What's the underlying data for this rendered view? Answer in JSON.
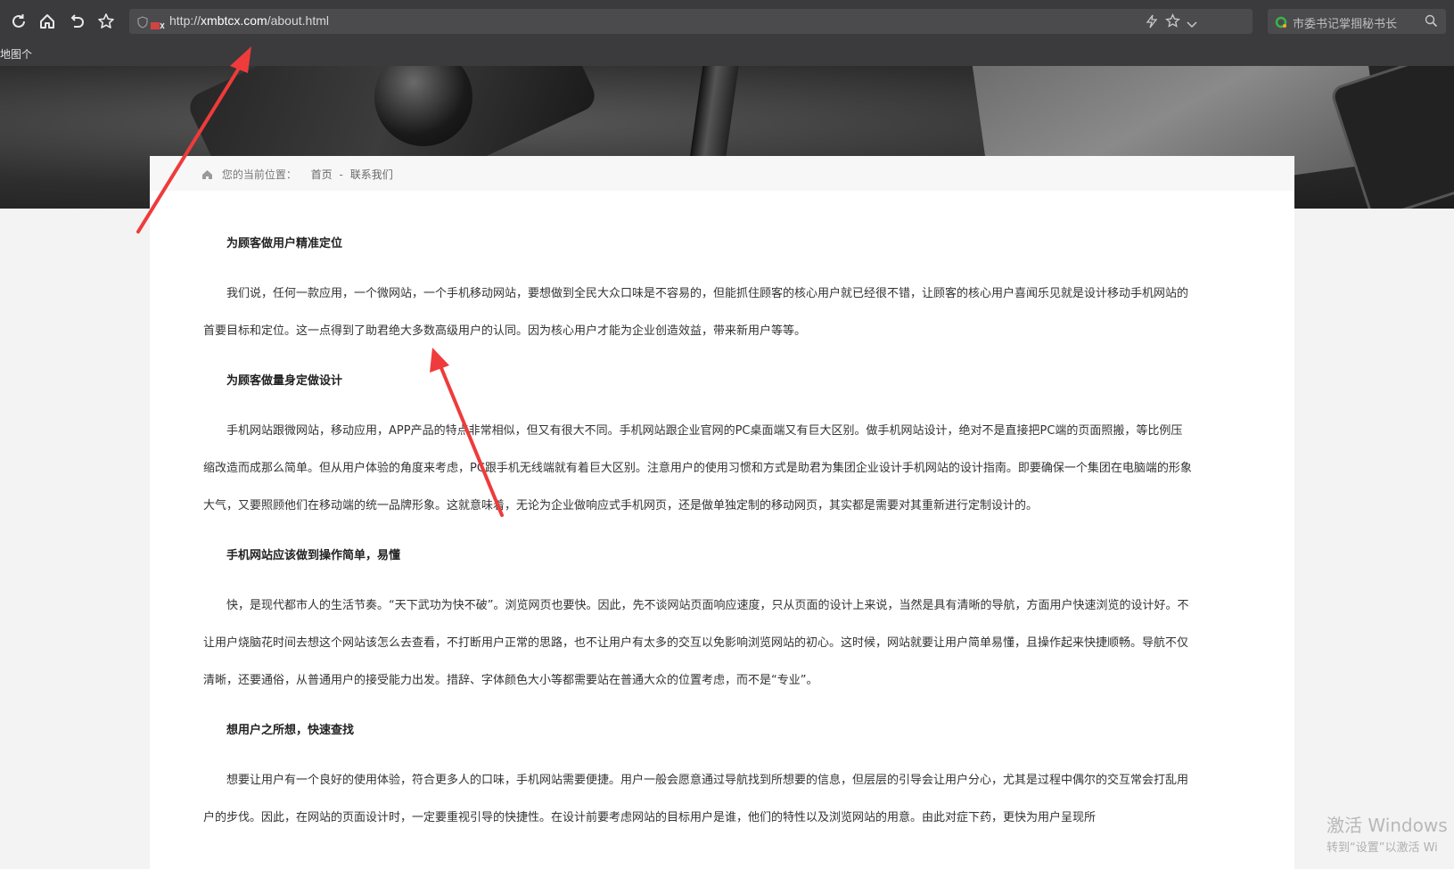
{
  "browser": {
    "url_prefix": "http://",
    "url_domain": "xmbtcx.com",
    "url_path": "/about.html",
    "search_text": "市委书记掌掴秘书长",
    "bookmark": "地图个"
  },
  "breadcrumb": {
    "label": "您的当前位置：",
    "home": "首页",
    "separator": "-",
    "current": "联系我们"
  },
  "article": {
    "sections": [
      {
        "heading": "为顾客做用户精准定位",
        "paragraph": "我们说，任何一款应用，一个微网站，一个手机移动网站，要想做到全民大众口味是不容易的，但能抓住顾客的核心用户就已经很不错，让顾客的核心用户喜闻乐见就是设计移动手机网站的首要目标和定位。这一点得到了助君绝大多数高级用户的认同。因为核心用户才能为企业创造效益，带来新用户等等。"
      },
      {
        "heading": "为顾客做量身定做设计",
        "paragraph": "手机网站跟微网站，移动应用，APP产品的特点非常相似，但又有很大不同。手机网站跟企业官网的PC桌面端又有巨大区别。做手机网站设计，绝对不是直接把PC端的页面照搬，等比例压缩改造而成那么简单。但从用户体验的角度来考虑，PC跟手机无线端就有着巨大区别。注意用户的使用习惯和方式是助君为集团企业设计手机网站的设计指南。即要确保一个集团在电脑端的形象大气，又要照顾他们在移动端的统一品牌形象。这就意味着，无论为企业做响应式手机网页，还是做单独定制的移动网页，其实都是需要对其重新进行定制设计的。"
      },
      {
        "heading": "手机网站应该做到操作简单，易懂",
        "paragraph": "快，是现代都市人的生活节奏。“天下武功为快不破”。浏览网页也要快。因此，先不谈网站页面响应速度，只从页面的设计上来说，当然是具有清晰的导航，方面用户快速浏览的设计好。不让用户烧脑花时间去想这个网站该怎么去查看，不打断用户正常的思路，也不让用户有太多的交互以免影响浏览网站的初心。这时候，网站就要让用户简单易懂，且操作起来快捷顺畅。导航不仅清晰，还要通俗，从普通用户的接受能力出发。措辞、字体颜色大小等都需要站在普通大众的位置考虑，而不是“专业”。"
      },
      {
        "heading": "想用户之所想，快速查找",
        "paragraph": "想要让用户有一个良好的使用体验，符合更多人的口味，手机网站需要便捷。用户一般会愿意通过导航找到所想要的信息，但层层的引导会让用户分心，尤其是过程中偶尔的交互常会打乱用户的步伐。因此，在网站的页面设计时，一定要重视引导的快捷性。在设计前要考虑网站的目标用户是谁，他们的特性以及浏览网站的用意。由此对症下药，更快为用户呈现所"
      }
    ]
  },
  "watermark": {
    "title": "激活 Windows",
    "subtitle": "转到“设置”以激活 Wi"
  },
  "colors": {
    "chrome": "#3b3b3d",
    "arrow": "#ef3b3b"
  }
}
